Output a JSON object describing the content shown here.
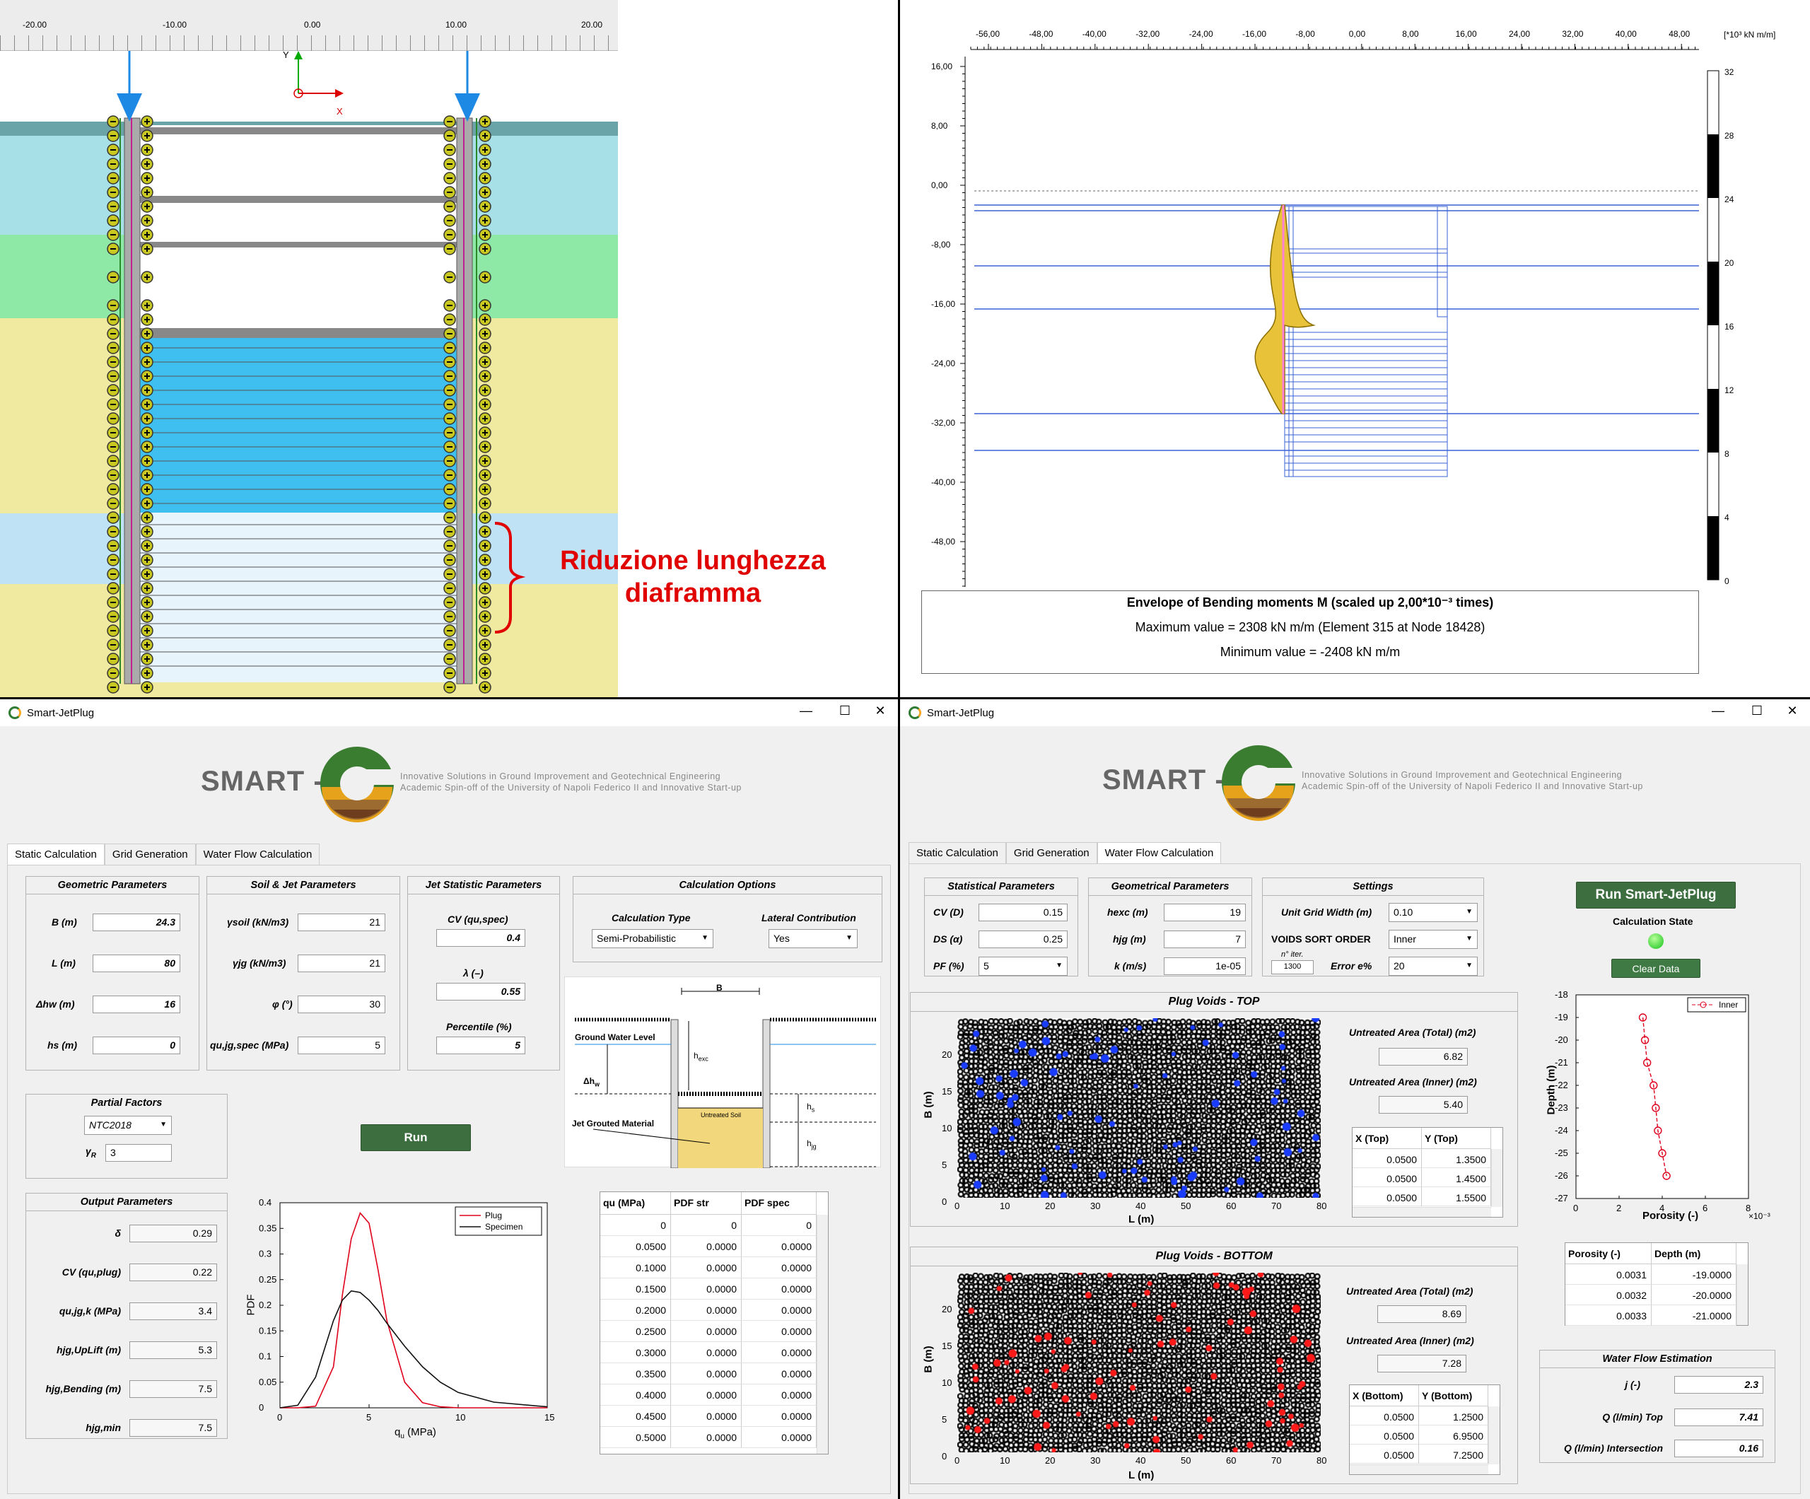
{
  "q1": {
    "ruler_ticks": [
      "-20.00",
      "-10.00",
      "0.00",
      "10.00",
      "20.00"
    ],
    "axis_y": "Y",
    "axis_x": "X",
    "annotation_line1": "Riduzione lunghezza",
    "annotation_line2": "diaframma",
    "colors": {
      "sky": "#a8e0e8",
      "green": "#8ee8a6",
      "sand": "#f0e9a0",
      "water": "#3fbfef",
      "light": "#bfe3f5",
      "annotation": "#e00000"
    }
  },
  "q2": {
    "x_ticks": [
      "-56,00",
      "-48,00",
      "-40,00",
      "-32,00",
      "-24,00",
      "-16,00",
      "-8,00",
      "0,00",
      "8,00",
      "16,00",
      "24,00",
      "32,00",
      "40,00",
      "48,00"
    ],
    "x_unit": "[*10³ kN m/m]",
    "y_ticks": [
      "16,00",
      "8,00",
      "0,00",
      "-8,00",
      "-16,00",
      "-24,00",
      "-32,00",
      "-40,00",
      "-48,00"
    ],
    "scale_ticks": [
      "32",
      "28",
      "24",
      "20",
      "16",
      "12",
      "8",
      "4",
      "0"
    ],
    "info_title": "Envelope of Bending moments M (scaled up 2,00*10⁻³ times)",
    "info_max": "Maximum value = 2308 kN m/m (Element 315 at Node 18428)",
    "info_min": "Minimum value = -2408 kN m/m"
  },
  "app_left": {
    "title": "Smart-JetPlug",
    "logo_word": "SMART -",
    "tagline1": "Innovative Solutions in Ground Improvement and Geotechnical Engineering",
    "tagline2": "Academic Spin-off of the University of Napoli Federico II and Innovative Start-up",
    "tabs": [
      "Static Calculation",
      "Grid Generation",
      "Water Flow Calculation"
    ],
    "geom": {
      "title": "Geometric Parameters",
      "B_label": "B (m)",
      "B": "24.3",
      "L_label": "L (m)",
      "L": "80",
      "dhw_label": "Δhw (m)",
      "dhw": "16",
      "hs_label": "hs (m)",
      "hs": "0"
    },
    "soil": {
      "title": "Soil & Jet Parameters",
      "gsoil_label": "γsoil (kN/m3)",
      "gsoil": "21",
      "gjg_label": "γjg (kN/m3)",
      "gjg": "21",
      "phi_label": "φ (°)",
      "phi": "30",
      "qu_label": "qu,jg,spec (MPa)",
      "qu": "5"
    },
    "jet": {
      "title": "Jet Statistic Parameters",
      "cv_label": "CV (qu,spec)",
      "cv": "0.4",
      "lam_label": "λ (–)",
      "lam": "0.55",
      "pct_label": "Percentile (%)",
      "pct": "5"
    },
    "calc": {
      "title": "Calculation Options",
      "type_label": "Calculation Type",
      "type": "Semi-Probabilistic",
      "lat_label": "Lateral Contribution",
      "lat": "Yes"
    },
    "diagram": {
      "B": "B",
      "gwl": "Ground Water Level",
      "hexc": "h",
      "hexc_sub": "exc",
      "dhw": "Δh",
      "dhw_sub": "w",
      "untreated": "Untreated Soil",
      "jgm": "Jet Grouted Material",
      "hs": "h",
      "hs_sub": "s",
      "hjg": "h",
      "hjg_sub": "jg"
    },
    "partial": {
      "title": "Partial Factors",
      "code": "NTC2018",
      "gr_label": "γ",
      "gr_sub": "R",
      "gr": "3"
    },
    "run": "Run",
    "output": {
      "title": "Output Parameters",
      "delta_label": "δ",
      "delta": "0.29",
      "cv_label": "CV (qu,plug)",
      "cv": "0.22",
      "qk_label": "qu,jg,k (MPa)",
      "qk": "3.4",
      "up_label": "hjg,UpLift (m)",
      "up": "5.3",
      "bend_label": "hjg,Bending (m)",
      "bend": "7.5",
      "min_label": "hjg,min",
      "min": "7.5"
    },
    "pdf_chart": {
      "ylabel": "PDF",
      "xlabel": "q",
      "xlabel_sub": "u",
      "xlabel_unit": "(MPa)",
      "legend": [
        "Plug",
        "Specimen"
      ]
    },
    "pdf_table": {
      "headers": [
        "qu (MPa)",
        "PDF str",
        "PDF spec"
      ],
      "rows": [
        [
          "0",
          "0",
          "0"
        ],
        [
          "0.0500",
          "0.0000",
          "0.0000"
        ],
        [
          "0.1000",
          "0.0000",
          "0.0000"
        ],
        [
          "0.1500",
          "0.0000",
          "0.0000"
        ],
        [
          "0.2000",
          "0.0000",
          "0.0000"
        ],
        [
          "0.2500",
          "0.0000",
          "0.0000"
        ],
        [
          "0.3000",
          "0.0000",
          "0.0000"
        ],
        [
          "0.3500",
          "0.0000",
          "0.0000"
        ],
        [
          "0.4000",
          "0.0000",
          "0.0000"
        ],
        [
          "0.4500",
          "0.0000",
          "0.0000"
        ],
        [
          "0.5000",
          "0.0000",
          "0.0000"
        ]
      ]
    }
  },
  "app_right": {
    "title": "Smart-JetPlug",
    "logo_word": "SMART -",
    "tagline1": "Innovative Solutions in Ground Improvement and Geotechnical Engineering",
    "tagline2": "Academic Spin-off of the University of Napoli Federico II and Innovative Start-up",
    "tabs": [
      "Static Calculation",
      "Grid Generation",
      "Water Flow Calculation"
    ],
    "stat": {
      "title": "Statistical Parameters",
      "cv_label": "CV (D)",
      "cv": "0.15",
      "ds_label": "DS (α)",
      "ds": "0.25",
      "pf_label": "PF (%)",
      "pf": "5"
    },
    "geo": {
      "title": "Geometrical Parameters",
      "hexc_label": "hexc (m)",
      "hexc": "19",
      "hjg_label": "hjg (m)",
      "hjg": "7",
      "k_label": "k (m/s)",
      "k": "1e-05"
    },
    "settings": {
      "title": "Settings",
      "ugw_label": "Unit Grid Width (m)",
      "ugw": "0.10",
      "vso_label": "VOIDS SORT ORDER",
      "vso": "Inner",
      "iter_label": "n° iter.",
      "iter": "1300",
      "err_label": "Error e%",
      "err": "20"
    },
    "run": "Run Smart-JetPlug",
    "calc_state": "Calculation State",
    "clear": "Clear Data",
    "top": {
      "title": "Plug Voids - TOP",
      "ua_total_label": "Untreated Area (Total) (m2)",
      "ua_total": "6.82",
      "ua_inner_label": "Untreated Area (Inner) (m2)",
      "ua_inner": "5.40",
      "headers": [
        "X (Top)",
        "Y (Top)"
      ],
      "rows": [
        [
          "0.0500",
          "1.3500"
        ],
        [
          "0.0500",
          "1.4500"
        ],
        [
          "0.0500",
          "1.5500"
        ]
      ]
    },
    "bottom": {
      "title": "Plug Voids - BOTTOM",
      "ua_total_label": "Untreated Area (Total) (m2)",
      "ua_total": "8.69",
      "ua_inner_label": "Untreated Area (Inner) (m2)",
      "ua_inner": "7.28",
      "headers": [
        "X (Bottom)",
        "Y (Bottom)"
      ],
      "rows": [
        [
          "0.0500",
          "1.2500"
        ],
        [
          "0.0500",
          "6.9500"
        ],
        [
          "0.0500",
          "7.2500"
        ]
      ]
    },
    "voids_x_ticks": [
      "0",
      "10",
      "20",
      "30",
      "40",
      "50",
      "60",
      "70",
      "80"
    ],
    "voids_y_ticks": [
      "20",
      "15",
      "10",
      "5",
      "0"
    ],
    "voids_xlabel": "L  (m)",
    "voids_ylabel": "B  (m)",
    "porosity_chart": {
      "ylabel": "Depth  (m)",
      "xlabel": "Porosity  (-)",
      "xexp": "×10⁻³",
      "legend": "Inner",
      "y_ticks": [
        "-18",
        "-19",
        "-20",
        "-21",
        "-22",
        "-23",
        "-24",
        "-25",
        "-26",
        "-27"
      ],
      "x_ticks": [
        "0",
        "2",
        "4",
        "6",
        "8"
      ]
    },
    "porosity_table": {
      "headers": [
        "Porosity (-)",
        "Depth (m)"
      ],
      "rows": [
        [
          "0.0031",
          "-19.0000"
        ],
        [
          "0.0032",
          "-20.0000"
        ],
        [
          "0.0033",
          "-21.0000"
        ]
      ]
    },
    "wf": {
      "title": "Water Flow Estimation",
      "j_label": "j (-)",
      "j": "2.3",
      "qtop_label": "Q (l/min) Top",
      "qtop": "7.41",
      "qint_label": "Q (l/min) Intersection",
      "qint": "0.16"
    }
  },
  "chart_data": [
    {
      "type": "line",
      "title": "",
      "xlabel": "qu (MPa)",
      "ylabel": "PDF",
      "xlim": [
        0,
        15
      ],
      "ylim": [
        0,
        0.4
      ],
      "x": [
        0,
        1,
        2,
        3,
        3.5,
        4,
        4.5,
        5,
        5.5,
        6,
        7,
        8,
        9,
        10,
        12,
        15
      ],
      "series": [
        {
          "name": "Plug",
          "values": [
            0,
            0,
            0.003,
            0.08,
            0.22,
            0.33,
            0.38,
            0.36,
            0.27,
            0.17,
            0.05,
            0.01,
            0.002,
            0,
            0,
            0
          ]
        },
        {
          "name": "Specimen",
          "values": [
            0,
            0.005,
            0.06,
            0.17,
            0.21,
            0.228,
            0.225,
            0.21,
            0.19,
            0.165,
            0.12,
            0.08,
            0.05,
            0.03,
            0.011,
            0.002
          ]
        }
      ]
    },
    {
      "type": "line",
      "title": "",
      "xlabel": "Porosity (-) ×10⁻³",
      "ylabel": "Depth (m)",
      "xlim": [
        0,
        8
      ],
      "ylim": [
        -27,
        -18
      ],
      "series": [
        {
          "name": "Inner",
          "x": [
            3.1,
            3.2,
            3.3,
            3.6,
            3.7,
            3.8,
            4.0,
            4.2
          ],
          "y": [
            -19,
            -20,
            -21,
            -22,
            -23,
            -24,
            -25,
            -26
          ]
        }
      ]
    }
  ]
}
